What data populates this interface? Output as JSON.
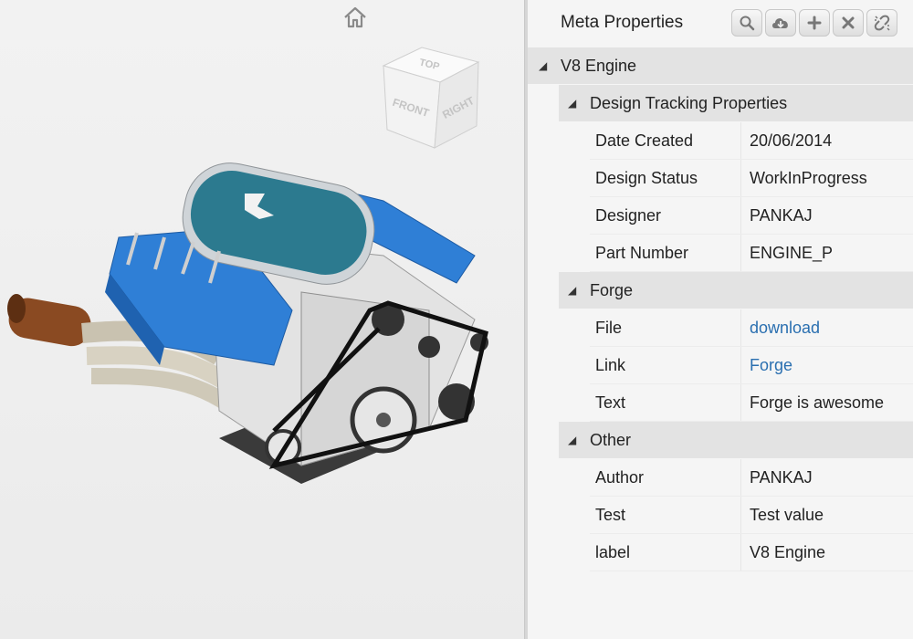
{
  "viewer": {
    "viewcube": {
      "top": "TOP",
      "front": "FRONT",
      "right": "RIGHT"
    }
  },
  "panel": {
    "title": "Meta Properties",
    "toolbar": [
      {
        "icon": "search-icon"
      },
      {
        "icon": "cloud-download-icon"
      },
      {
        "icon": "plus-icon"
      },
      {
        "icon": "close-icon"
      },
      {
        "icon": "unlink-icon"
      }
    ],
    "root": {
      "label": "V8 Engine"
    },
    "groups": [
      {
        "label": "Design Tracking Properties",
        "props": [
          {
            "name": "Date Created",
            "value": "20/06/2014"
          },
          {
            "name": "Design Status",
            "value": "WorkInProgress"
          },
          {
            "name": "Designer",
            "value": "PANKAJ"
          },
          {
            "name": "Part Number",
            "value": "ENGINE_P"
          }
        ]
      },
      {
        "label": "Forge",
        "props": [
          {
            "name": "File",
            "value": "download",
            "link": true
          },
          {
            "name": "Link",
            "value": "Forge",
            "link": true
          },
          {
            "name": "Text",
            "value": "Forge is awesome"
          }
        ]
      },
      {
        "label": "Other",
        "props": [
          {
            "name": "Author",
            "value": "PANKAJ"
          },
          {
            "name": "Test",
            "value": "Test value"
          },
          {
            "name": "label",
            "value": "V8 Engine"
          }
        ]
      }
    ]
  },
  "colors": {
    "accent_blue": "#2f7fd6",
    "link": "#2a6fb0",
    "header_bg": "#e3e3e3"
  }
}
